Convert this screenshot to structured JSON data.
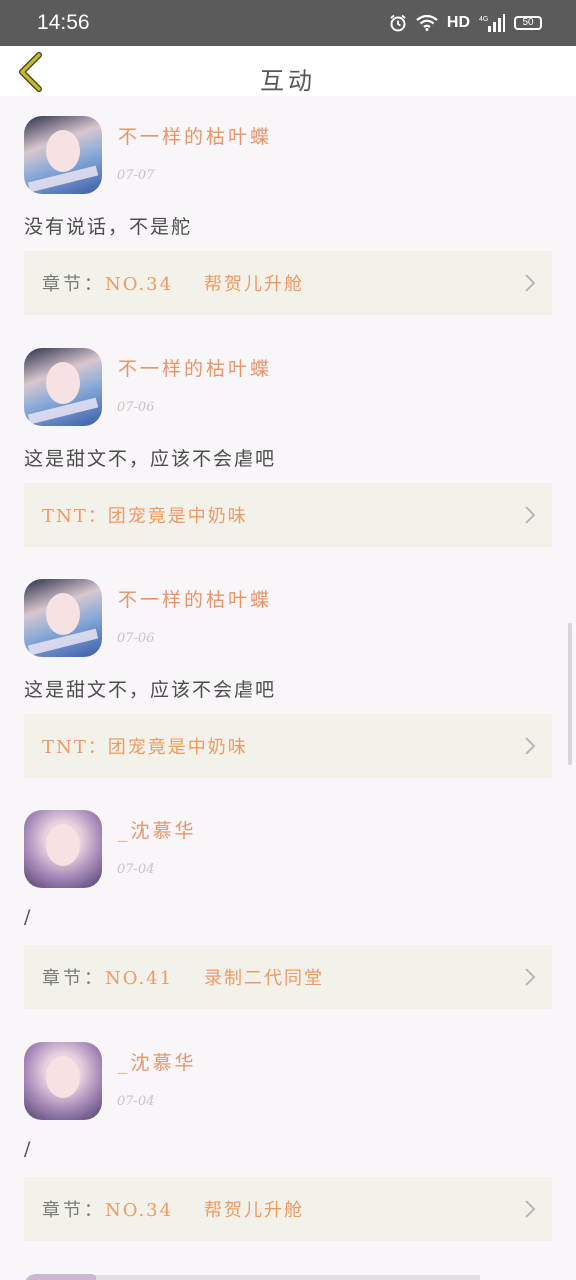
{
  "status_bar": {
    "time": "14:56",
    "network": "HD",
    "signal": "4G",
    "battery": "50",
    "icons": [
      "alarm-icon",
      "wifi-icon",
      "signal-icon",
      "battery-icon"
    ]
  },
  "header": {
    "title": "互动",
    "back_icon": "chevron-left-icon"
  },
  "colors": {
    "accent": "#ee9a64",
    "card_bg": "#f3f2ea",
    "page_bg": "#f8f6f8",
    "back_icon": "#c7b92d"
  },
  "items": [
    {
      "username": "不一样的枯叶蝶",
      "date": "07-07",
      "comment": "没有说话，不是舵",
      "chapter_prefix": "章节：",
      "chapter": "NO.34    帮贺儿升舱",
      "avatar": "girl-a"
    },
    {
      "username": "不一样的枯叶蝶",
      "date": "07-06",
      "comment": "这是甜文不，应该不会虐吧",
      "chapter_prefix": "",
      "chapter": "TNT：团宠竟是中奶味",
      "avatar": "girl-a"
    },
    {
      "username": "不一样的枯叶蝶",
      "date": "07-06",
      "comment": "这是甜文不，应该不会虐吧",
      "chapter_prefix": "",
      "chapter": "TNT：团宠竟是中奶味",
      "avatar": "girl-a"
    },
    {
      "username": "_沈慕华",
      "date": "07-04",
      "comment": "/",
      "chapter_prefix": "章节：",
      "chapter": "NO.41    录制二代同堂",
      "avatar": "girl-b"
    },
    {
      "username": "_沈慕华",
      "date": "07-04",
      "comment": "/",
      "chapter_prefix": "章节：",
      "chapter": "NO.34    帮贺儿升舱",
      "avatar": "girl-b"
    }
  ]
}
